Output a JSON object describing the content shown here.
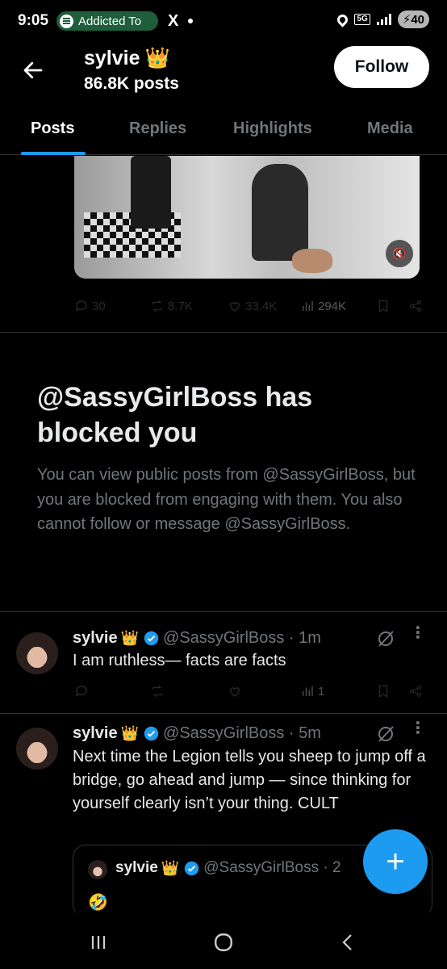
{
  "status_bar": {
    "time": "9:05",
    "media_pill": "Addicted To",
    "x_label": "X",
    "network": "5G",
    "battery": "40"
  },
  "header": {
    "name": "sylvie",
    "crown": "👑",
    "post_count": "86.8K posts",
    "follow_label": "Follow"
  },
  "tabs": [
    {
      "label": "Posts",
      "active": true
    },
    {
      "label": "Replies"
    },
    {
      "label": "Highlights"
    },
    {
      "label": "Media"
    }
  ],
  "video_tweet": {
    "replies": "30",
    "reposts": "8.7K",
    "likes": "33.4K",
    "views": "294K"
  },
  "blocked_notice": {
    "title": "@SassyGirlBoss has blocked you",
    "body": "You can view public posts from @SassyGirlBoss, but you are blocked from engaging with them. You also cannot follow or message @SassyGirlBoss."
  },
  "tweets": [
    {
      "name": "sylvie",
      "crown": "👑",
      "handle_time": "@SassyGirlBoss · 1m",
      "text": "I am ruthless— facts are facts",
      "views": "1"
    },
    {
      "name": "sylvie",
      "crown": "👑",
      "handle_time": "@SassyGirlBoss · 5m",
      "text": "Next time the Legion tells you sheep to jump off a bridge, go ahead and jump — since thinking for yourself clearly isn’t your thing. CULT",
      "quote": {
        "name": "sylvie",
        "crown": "👑",
        "handle_time": "@SassyGirlBoss · 2",
        "emoji": "🤣"
      }
    }
  ],
  "fab_label": "+",
  "colors": {
    "accent": "#1d9bf0",
    "background": "#000000",
    "muted": "#71767b",
    "text": "#e7e9ea"
  }
}
